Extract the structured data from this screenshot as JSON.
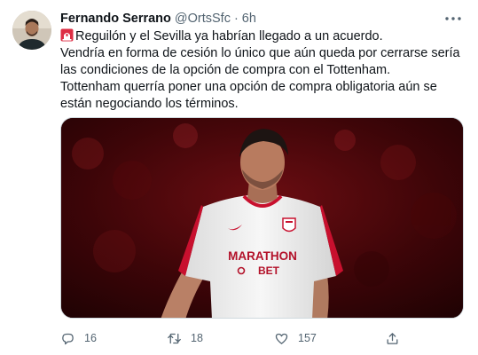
{
  "tweet": {
    "author_name": "Fernando Serrano",
    "handle": "@OrtsSfc",
    "separator": "·",
    "time": "6h",
    "lines": [
      "Reguilón y el Sevilla ya habrían llegado a un acuerdo.",
      "Vendría en forma de cesión lo único que aún queda por cerrarse sería las condiciones de la opción de compra con el Tottenham.",
      "Tottenham querría poner una opción de compra obligatoria aún se están negociando los términos."
    ],
    "emoji": "rotating-light-icon",
    "photo": {
      "shirt_sponsor_line1": "MARATHON",
      "shirt_sponsor_line2": "BET"
    }
  },
  "actions": {
    "reply_count": "16",
    "retweet_count": "18",
    "like_count": "157"
  },
  "colors": {
    "text_primary": "#0f1419",
    "text_secondary": "#536471",
    "siren_red": "#e0245e",
    "shirt_red": "#c8102e"
  }
}
